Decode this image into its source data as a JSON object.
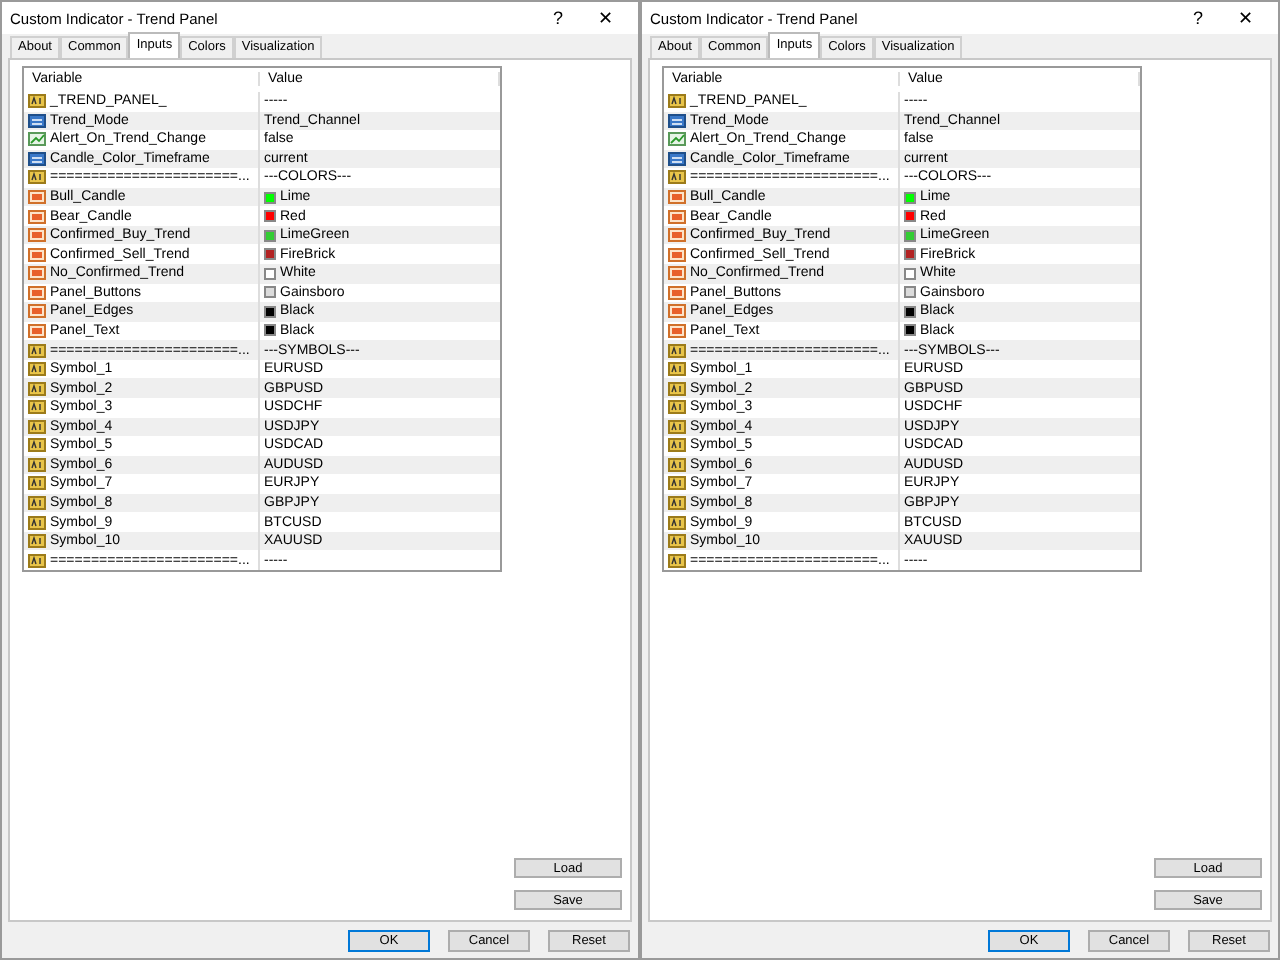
{
  "dialogs": [
    {
      "title": "Custom Indicator - Trend Panel",
      "help": "?",
      "close": "✕",
      "tabs": [
        {
          "label": "About",
          "selected": false
        },
        {
          "label": "Common",
          "selected": false
        },
        {
          "label": "Inputs",
          "selected": true
        },
        {
          "label": "Colors",
          "selected": false
        },
        {
          "label": "Visualization",
          "selected": false
        }
      ],
      "table": {
        "columns": [
          "Variable",
          "Value"
        ],
        "rows": [
          {
            "kind": "string",
            "variable": "_TREND_PANEL_",
            "value": "-----"
          },
          {
            "kind": "enum",
            "variable": "Trend_Mode",
            "value": "Trend_Channel"
          },
          {
            "kind": "bool",
            "variable": "Alert_On_Trend_Change",
            "value": "false"
          },
          {
            "kind": "enum",
            "variable": "Candle_Color_Timeframe",
            "value": "current"
          },
          {
            "kind": "string",
            "variable": "=======================...",
            "value": "---COLORS---"
          },
          {
            "kind": "color",
            "variable": "Bull_Candle",
            "value": "Lime",
            "color": "#00ff00"
          },
          {
            "kind": "color",
            "variable": "Bear_Candle",
            "value": "Red",
            "color": "#ff0000"
          },
          {
            "kind": "color",
            "variable": "Confirmed_Buy_Trend",
            "value": "LimeGreen",
            "color": "#32cd32"
          },
          {
            "kind": "color",
            "variable": "Confirmed_Sell_Trend",
            "value": "FireBrick",
            "color": "#b22222"
          },
          {
            "kind": "color",
            "variable": "No_Confirmed_Trend",
            "value": "White",
            "color": "#ffffff"
          },
          {
            "kind": "color",
            "variable": "Panel_Buttons",
            "value": "Gainsboro",
            "color": "#dcdcdc"
          },
          {
            "kind": "color",
            "variable": "Panel_Edges",
            "value": "Black",
            "color": "#000000"
          },
          {
            "kind": "color",
            "variable": "Panel_Text",
            "value": "Black",
            "color": "#000000"
          },
          {
            "kind": "string",
            "variable": "=======================...",
            "value": "---SYMBOLS---"
          },
          {
            "kind": "string",
            "variable": "Symbol_1",
            "value": "EURUSD"
          },
          {
            "kind": "string",
            "variable": "Symbol_2",
            "value": "GBPUSD"
          },
          {
            "kind": "string",
            "variable": "Symbol_3",
            "value": "USDCHF"
          },
          {
            "kind": "string",
            "variable": "Symbol_4",
            "value": "USDJPY"
          },
          {
            "kind": "string",
            "variable": "Symbol_5",
            "value": "USDCAD"
          },
          {
            "kind": "string",
            "variable": "Symbol_6",
            "value": "AUDUSD"
          },
          {
            "kind": "string",
            "variable": "Symbol_7",
            "value": "EURJPY"
          },
          {
            "kind": "string",
            "variable": "Symbol_8",
            "value": "GBPJPY"
          },
          {
            "kind": "string",
            "variable": "Symbol_9",
            "value": "BTCUSD"
          },
          {
            "kind": "string",
            "variable": "Symbol_10",
            "value": "XAUUSD"
          },
          {
            "kind": "string",
            "variable": "=======================...",
            "value": "-----"
          }
        ]
      },
      "side_buttons": [
        "Load",
        "Save"
      ],
      "buttons": [
        "OK",
        "Cancel",
        "Reset"
      ]
    },
    {
      "title": "Custom Indicator - Trend Panel",
      "help": "?",
      "close": "✕",
      "tabs": [
        {
          "label": "About",
          "selected": false
        },
        {
          "label": "Common",
          "selected": false
        },
        {
          "label": "Inputs",
          "selected": true
        },
        {
          "label": "Colors",
          "selected": false
        },
        {
          "label": "Visualization",
          "selected": false
        }
      ],
      "table": {
        "columns": [
          "Variable",
          "Value"
        ],
        "rows": [
          {
            "kind": "string",
            "variable": "_TREND_PANEL_",
            "value": "-----"
          },
          {
            "kind": "enum",
            "variable": "Trend_Mode",
            "value": "Trend_Channel"
          },
          {
            "kind": "bool",
            "variable": "Alert_On_Trend_Change",
            "value": "false"
          },
          {
            "kind": "enum",
            "variable": "Candle_Color_Timeframe",
            "value": "current"
          },
          {
            "kind": "string",
            "variable": "=======================...",
            "value": "---COLORS---"
          },
          {
            "kind": "color",
            "variable": "Bull_Candle",
            "value": "Lime",
            "color": "#00ff00"
          },
          {
            "kind": "color",
            "variable": "Bear_Candle",
            "value": "Red",
            "color": "#ff0000"
          },
          {
            "kind": "color",
            "variable": "Confirmed_Buy_Trend",
            "value": "LimeGreen",
            "color": "#32cd32"
          },
          {
            "kind": "color",
            "variable": "Confirmed_Sell_Trend",
            "value": "FireBrick",
            "color": "#b22222"
          },
          {
            "kind": "color",
            "variable": "No_Confirmed_Trend",
            "value": "White",
            "color": "#ffffff"
          },
          {
            "kind": "color",
            "variable": "Panel_Buttons",
            "value": "Gainsboro",
            "color": "#dcdcdc"
          },
          {
            "kind": "color",
            "variable": "Panel_Edges",
            "value": "Black",
            "color": "#000000"
          },
          {
            "kind": "color",
            "variable": "Panel_Text",
            "value": "Black",
            "color": "#000000"
          },
          {
            "kind": "string",
            "variable": "=======================...",
            "value": "---SYMBOLS---"
          },
          {
            "kind": "string",
            "variable": "Symbol_1",
            "value": "EURUSD"
          },
          {
            "kind": "string",
            "variable": "Symbol_2",
            "value": "GBPUSD"
          },
          {
            "kind": "string",
            "variable": "Symbol_3",
            "value": "USDCHF"
          },
          {
            "kind": "string",
            "variable": "Symbol_4",
            "value": "USDJPY"
          },
          {
            "kind": "string",
            "variable": "Symbol_5",
            "value": "USDCAD"
          },
          {
            "kind": "string",
            "variable": "Symbol_6",
            "value": "AUDUSD"
          },
          {
            "kind": "string",
            "variable": "Symbol_7",
            "value": "EURJPY"
          },
          {
            "kind": "string",
            "variable": "Symbol_8",
            "value": "GBPJPY"
          },
          {
            "kind": "string",
            "variable": "Symbol_9",
            "value": "BTCUSD"
          },
          {
            "kind": "string",
            "variable": "Symbol_10",
            "value": "XAUUSD"
          },
          {
            "kind": "string",
            "variable": "=======================...",
            "value": "-----"
          }
        ]
      },
      "side_buttons": [
        "Load",
        "Save"
      ],
      "buttons": [
        "OK",
        "Cancel",
        "Reset"
      ]
    }
  ]
}
